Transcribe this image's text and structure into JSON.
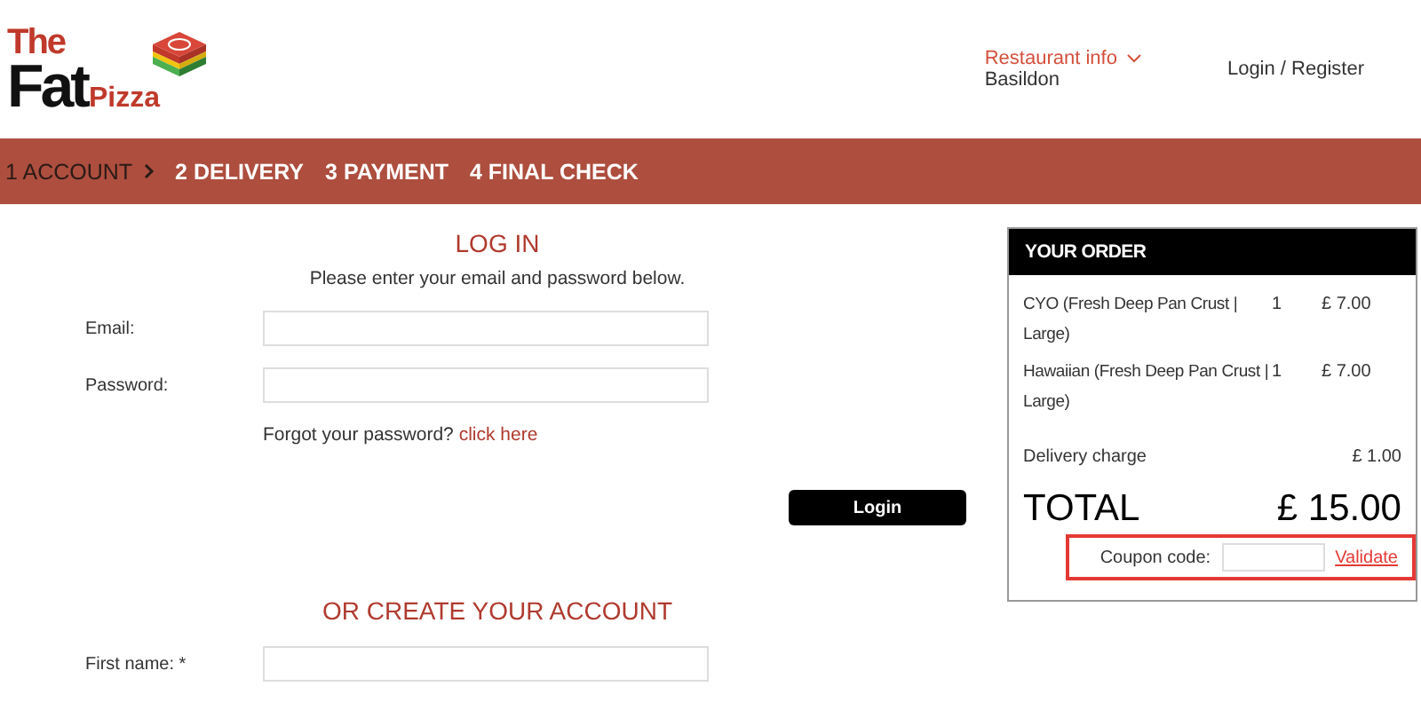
{
  "logo": {
    "line1": "The",
    "line2": "Fat",
    "line3": "Pizza"
  },
  "header": {
    "restaurant_info": "Restaurant info",
    "location": "Basildon",
    "account_link": "Login / Register"
  },
  "steps": [
    {
      "label": "1 ACCOUNT",
      "selected": true
    },
    {
      "label": "2 DELIVERY",
      "selected": false
    },
    {
      "label": "3 PAYMENT",
      "selected": false
    },
    {
      "label": "4 FINAL CHECK",
      "selected": false
    }
  ],
  "login": {
    "title": "LOG IN",
    "intro": "Please enter your email and password below.",
    "fields": [
      {
        "label": "Email:"
      },
      {
        "label": "Password:"
      }
    ],
    "forgot": "Forgot your password?",
    "forgot_link": "click here",
    "button": "Login"
  },
  "create": {
    "title": "OR CREATE YOUR ACCOUNT",
    "fields": [
      {
        "label": "First name: *"
      }
    ]
  },
  "order": {
    "title": "YOUR ORDER",
    "items": [
      {
        "name": "CYO (Fresh Deep Pan Crust | Large)",
        "qty": "1",
        "price": "£ 7.00"
      },
      {
        "name": "Hawaiian (Fresh Deep Pan Crust | Large)",
        "qty": "1",
        "price": "£ 7.00"
      }
    ],
    "delivery_label": "Delivery charge",
    "delivery_price": "£ 1.00",
    "total_label": "TOTAL",
    "total": "£ 15.00",
    "coupon_label": "Coupon code:",
    "validate": "Validate"
  }
}
